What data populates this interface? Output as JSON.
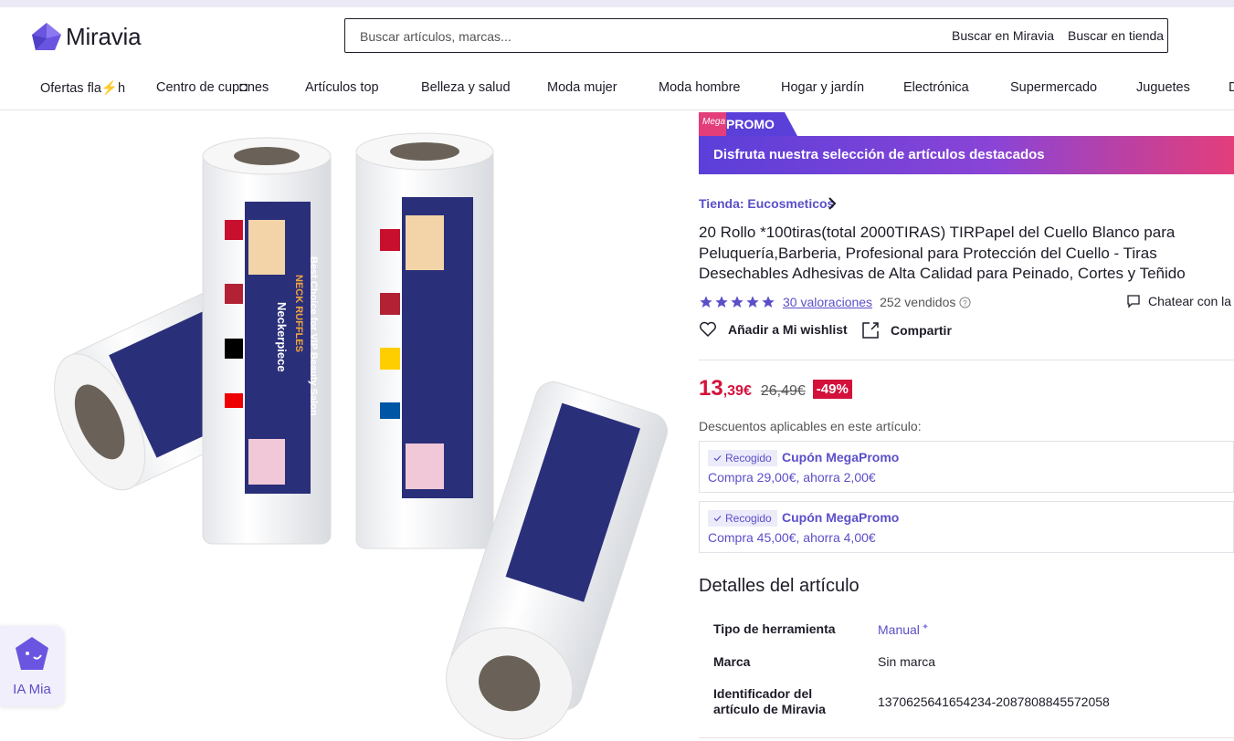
{
  "header": {
    "brand": "Miravia",
    "search": {
      "placeholder": "Buscar artículos, marcas...",
      "button_site": "Buscar en Miravia",
      "button_store": "Buscar en tienda"
    }
  },
  "nav": {
    "items": [
      {
        "label": "Ofertas fla⚡h"
      },
      {
        "label": "Centro de cup◘nes"
      },
      {
        "label": "Artículos top"
      },
      {
        "label": "Belleza y salud"
      },
      {
        "label": "Moda mujer"
      },
      {
        "label": "Moda hombre"
      },
      {
        "label": "Hogar y jardín"
      },
      {
        "label": "Electrónica"
      },
      {
        "label": "Supermercado"
      },
      {
        "label": "Juguetes"
      },
      {
        "label": "D"
      }
    ]
  },
  "assistant": {
    "label": "IA Mia"
  },
  "promo": {
    "badge_small": "Mega",
    "badge_big": "PROMO",
    "banner": "Disfruta nuestra selección de artículos destacados"
  },
  "product": {
    "store": "Tienda: Eucosmeticos",
    "title": "20 Rollo *100tiras(total 2000TIRAS) TIRPapel del Cuello Blanco para Peluquería,Barberia, Profesional para Protección del Cuello - Tiras Desechables Adhesivas de Alta Calidad para Peinado, Cortes y Teñido",
    "rating": 5,
    "reviews": "30 valoraciones",
    "sold": "252 vendidos",
    "chat": "Chatear con la tienda",
    "wishlist": "Añadir a Mi wishlist",
    "share": "Compartir",
    "price_int": "13",
    "price_dec": ",39€",
    "old_price": "26,49€",
    "discount": "-49%",
    "discounts_label": "Descuentos aplicables en este artículo:",
    "image_text": {
      "brand": "Neckerpiece",
      "line1": "NECK RUFFLES",
      "line2": "Best Choice for VIP Beauty Salon"
    }
  },
  "coupons": [
    {
      "tag": "Recogido",
      "title": "Cupón MegaPromo",
      "subtitle": "Compra 29,00€, ahorra 2,00€"
    },
    {
      "tag": "Recogido",
      "title": "Cupón MegaPromo",
      "subtitle": "Compra 45,00€, ahorra 4,00€"
    }
  ],
  "details": {
    "title": "Detalles del artículo",
    "rows": [
      {
        "key": "Tipo de herramienta",
        "value": "Manual"
      },
      {
        "key": "Marca",
        "value": "Sin marca"
      },
      {
        "key": "Identificador del artículo de Miravia",
        "value": "1370625641654234-2087808845572058"
      }
    ]
  },
  "colors": {
    "accent": "#5b4fc9",
    "price": "#d4113b",
    "banner_start": "#5b3fd9",
    "banner_end": "#e33e7a"
  }
}
